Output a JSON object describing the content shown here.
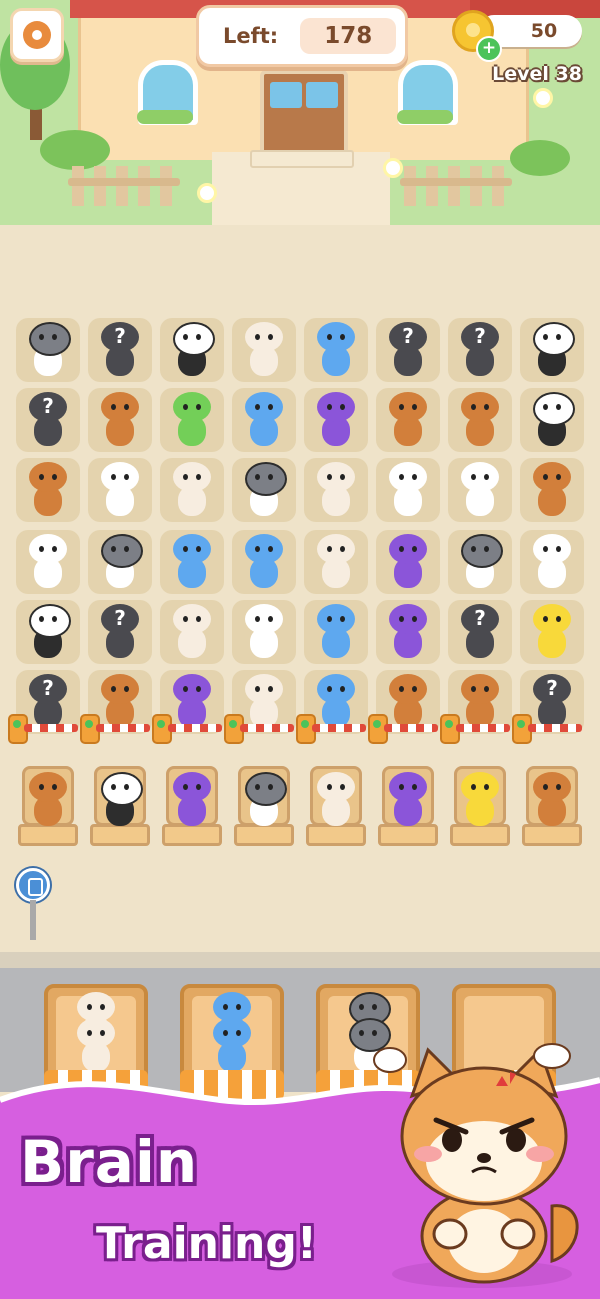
{
  "hud": {
    "settings_icon": "gear-icon",
    "left_label": "Left:",
    "left_value": "178",
    "coins": "50",
    "coin_icon": "paw-coin-icon",
    "add_icon": "plus-icon",
    "add_symbol": "+",
    "level": "Level 38"
  },
  "grid": {
    "rows": [
      [
        "husky",
        "hidden",
        "panda",
        "siamese",
        "blue-dino",
        "hidden",
        "hidden",
        "panda"
      ],
      [
        "hidden",
        "bear",
        "frog",
        "blue-dino",
        "purple-dino",
        "bear",
        "bear",
        "panda"
      ],
      [
        "bear",
        "duck",
        "siamese",
        "husky",
        "siamese",
        "duck",
        "duck",
        "bear"
      ],
      [
        "duck",
        "husky",
        "blue-dino",
        "blue-dino",
        "siamese",
        "purple-dino",
        "husky",
        "duck"
      ],
      [
        "panda",
        "hidden",
        "siamese",
        "duck",
        "blue-dino",
        "purple-dino",
        "hidden",
        "chick"
      ],
      [
        "hidden",
        "bear",
        "purple-dino",
        "siamese",
        "blue-dino",
        "bear",
        "bear",
        "hidden"
      ]
    ],
    "hidden_mark": "?"
  },
  "queue": [
    "bear",
    "panda",
    "purple-dino",
    "husky",
    "siamese",
    "purple-dino",
    "chick",
    "bear"
  ],
  "bus_stop_icon": "bus-stop-icon",
  "cars": [
    {
      "animal": "siamese",
      "count": 2
    },
    {
      "animal": "blue-dino",
      "count": 2
    },
    {
      "animal": "husky",
      "count": 2
    },
    {
      "animal": "empty",
      "count": 0
    }
  ],
  "promo": {
    "line1": "Brain",
    "line2": "Training!",
    "mascot": "angry-shiba-icon"
  },
  "colors": {
    "accent_purple": "#d65fe0",
    "tile": "#e4d3ae",
    "background": "#efe3c9"
  }
}
